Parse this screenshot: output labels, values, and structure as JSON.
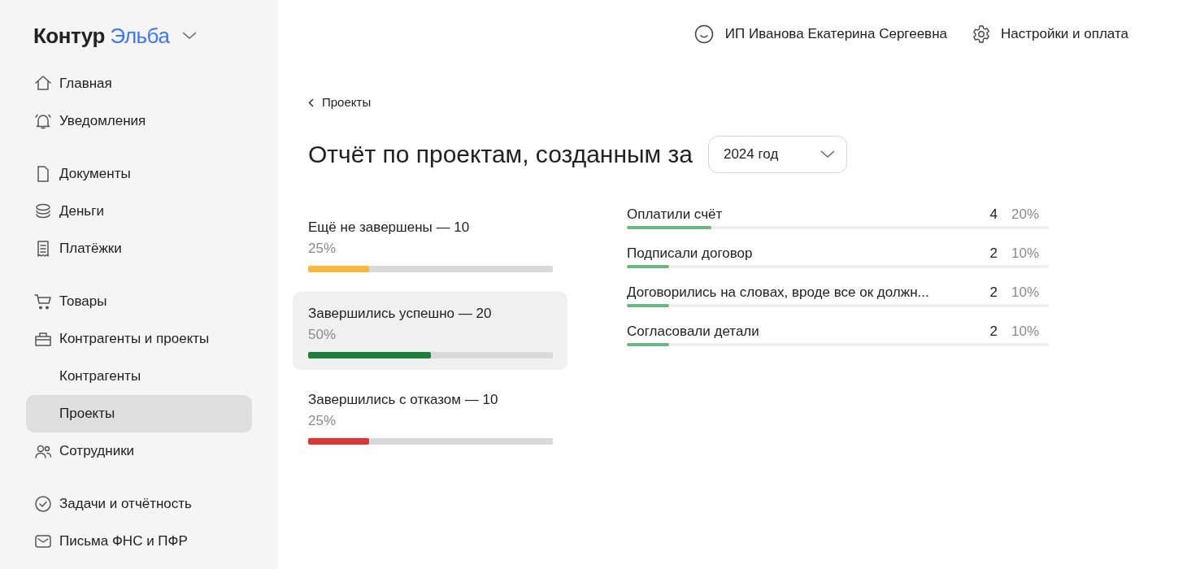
{
  "logo": {
    "brand": "Контур",
    "product": "Эльба"
  },
  "sidebar": {
    "groups": [
      [
        {
          "label": "Главная",
          "kind": "main",
          "selected": false
        },
        {
          "label": "Уведомления",
          "kind": "main",
          "selected": false
        }
      ],
      [
        {
          "label": "Документы",
          "kind": "main",
          "selected": false
        },
        {
          "label": "Деньги",
          "kind": "main",
          "selected": false
        },
        {
          "label": "Платёжки",
          "kind": "main",
          "selected": false
        }
      ],
      [
        {
          "label": "Товары",
          "kind": "main",
          "selected": false
        },
        {
          "label": "Контрагенты и проекты",
          "kind": "main",
          "selected": false
        },
        {
          "label": "Контрагенты",
          "kind": "sub",
          "selected": false
        },
        {
          "label": "Проекты",
          "kind": "sub",
          "selected": true
        },
        {
          "label": "Сотрудники",
          "kind": "main",
          "selected": false
        }
      ],
      [
        {
          "label": "Задачи и отчётность",
          "kind": "main",
          "selected": false
        },
        {
          "label": "Письма ФНС и ПФР",
          "kind": "main",
          "selected": false
        }
      ]
    ]
  },
  "header": {
    "user": "ИП Иванова Екатерина Сергеевна",
    "settings": "Настройки и оплата"
  },
  "breadcrumb": "Проекты",
  "title": "Отчёт по проектам, созданным за",
  "year_select": {
    "value": "2024 год"
  },
  "statuses": [
    {
      "label": "Ещё не завершены — 10",
      "percent": "25%",
      "level": 0.25,
      "color": "#fbb73c",
      "selected": false
    },
    {
      "label": "Завершились успешно — 20",
      "percent": "50%",
      "level": 0.5,
      "color": "#1c7f3a",
      "selected": true
    },
    {
      "label": "Завершились с отказом — 10",
      "percent": "25%",
      "level": 0.25,
      "color": "#e03535",
      "selected": false
    }
  ],
  "stages": [
    {
      "label": "Оплатили счёт",
      "count": "4",
      "percent": "20%",
      "level": 0.2
    },
    {
      "label": "Подписали договор",
      "count": "2",
      "percent": "10%",
      "level": 0.1
    },
    {
      "label": "Договорились на словах, вроде все ок должн...",
      "count": "2",
      "percent": "10%",
      "level": 0.1
    },
    {
      "label": "Согласовали детали",
      "count": "2",
      "percent": "10%",
      "level": 0.1
    }
  ]
}
